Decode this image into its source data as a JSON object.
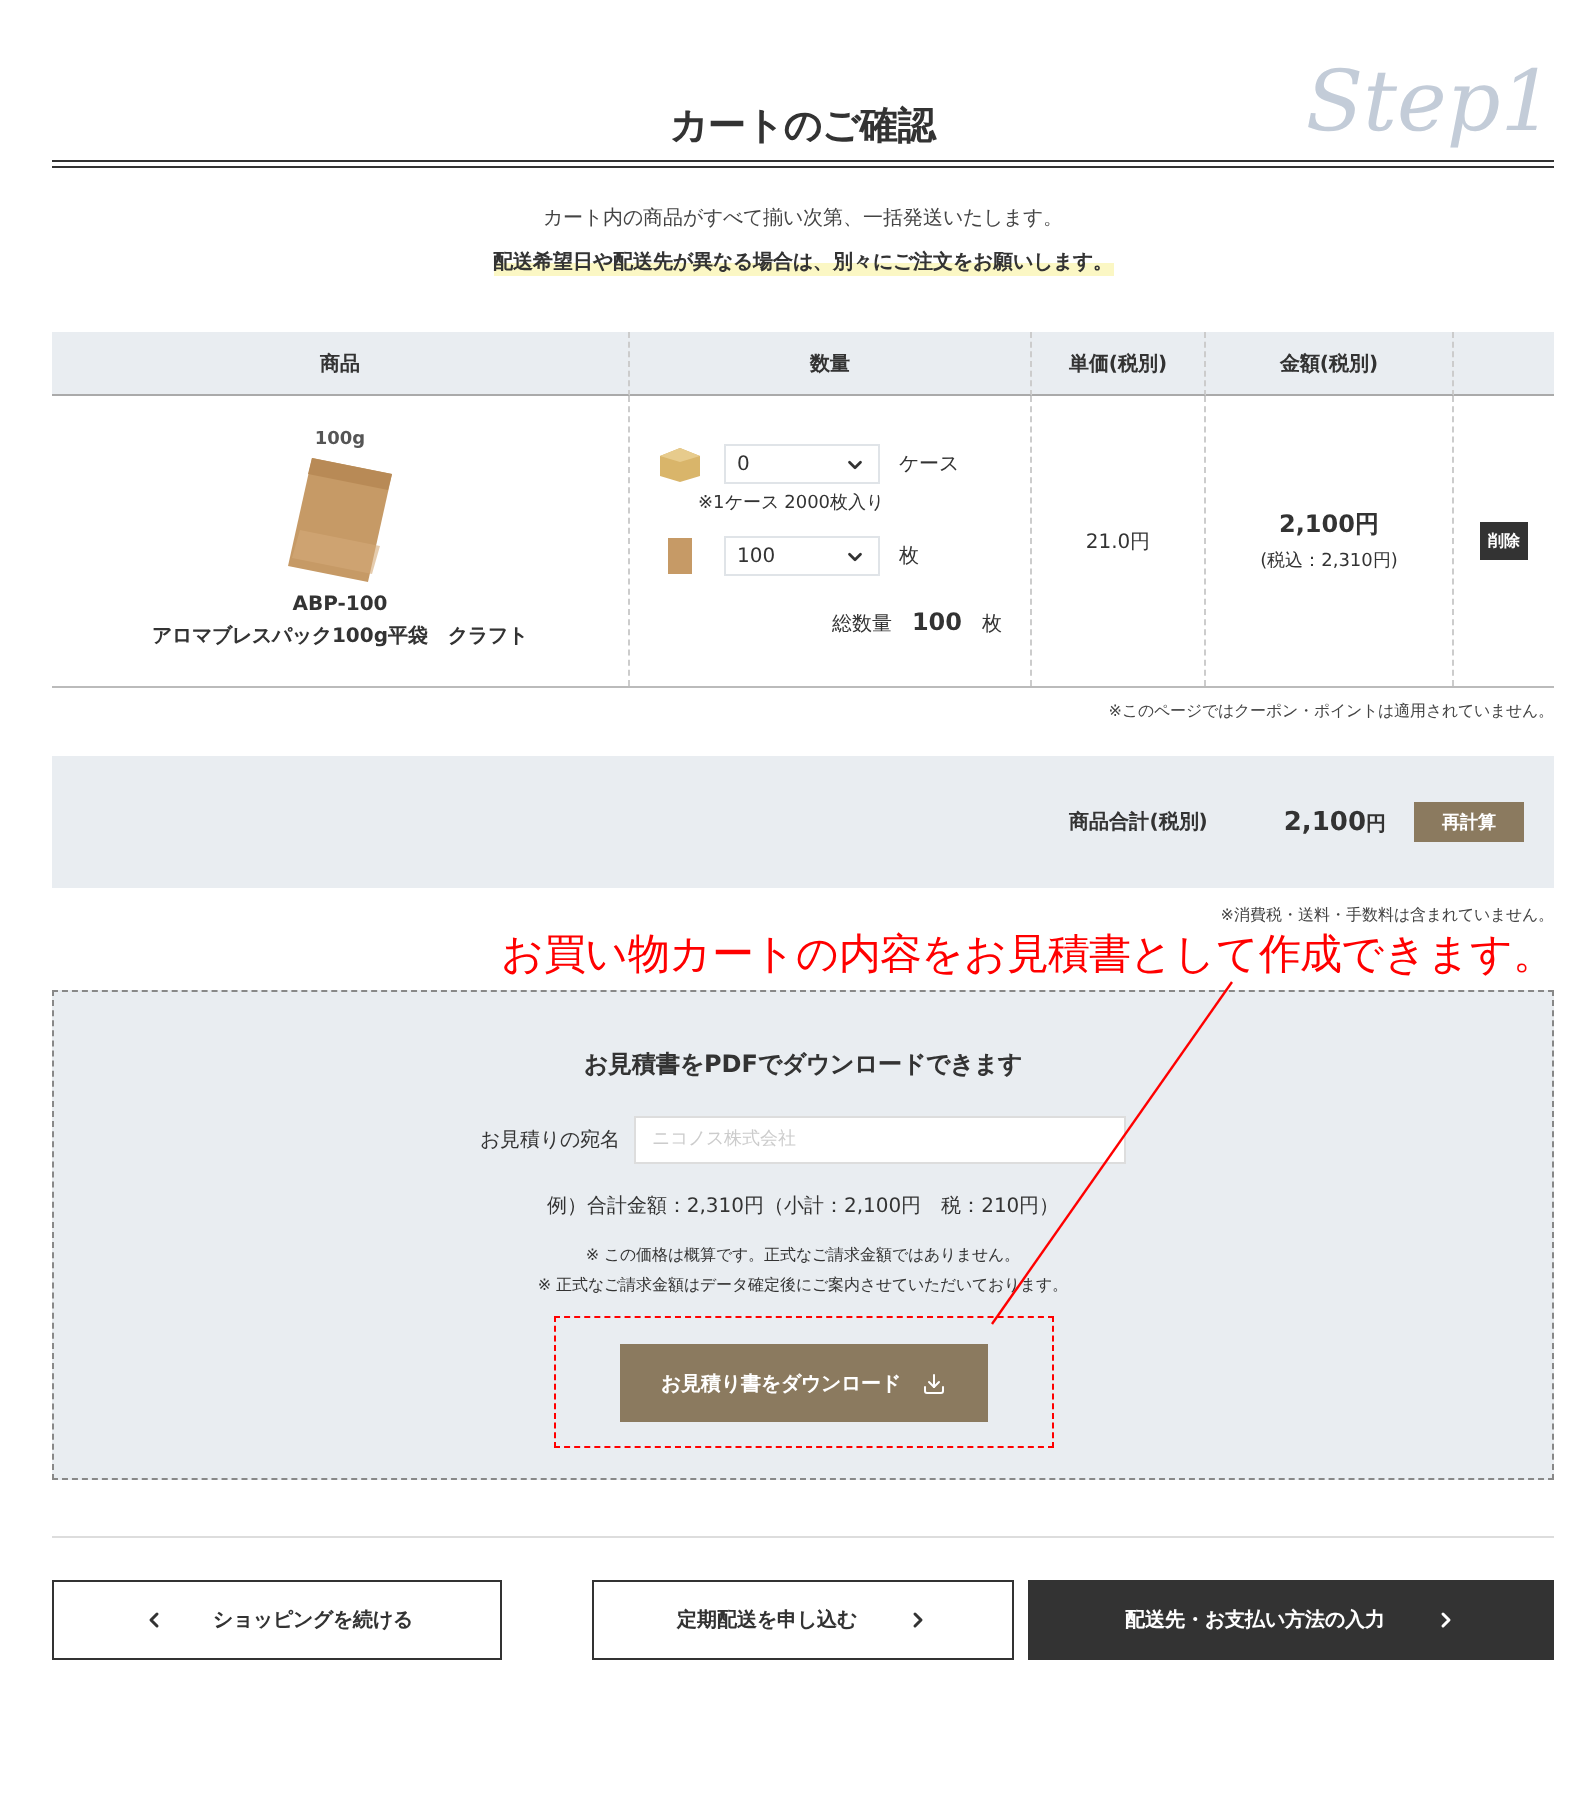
{
  "heading": {
    "title": "カートのご確認",
    "step": "Step1"
  },
  "intro": {
    "text": "カート内の商品がすべて揃い次第、一括発送いたします。",
    "highlight": "配送希望日や配送先が異なる場合は、別々にご注文をお願いします。"
  },
  "table": {
    "columns": [
      "商品",
      "数量",
      "単価(税別)",
      "金額(税別)"
    ],
    "rows": [
      {
        "size_label": "100g",
        "code": "ABP-100",
        "name": "アロマブレスパック100g平袋　クラフト",
        "quantities": [
          {
            "kind": "case",
            "value": "0",
            "unit": "ケース",
            "note": "※1ケース 2000枚入り"
          },
          {
            "kind": "sheet",
            "value": "100",
            "unit": "枚"
          }
        ],
        "total_label": "総数量",
        "total_qty": "100",
        "total_unit": "枚",
        "unit_price": "21.0円",
        "amount": "2,100円",
        "amount_incl": "(税込：2,310円)",
        "delete": "削除"
      }
    ]
  },
  "coupon_note": "※このページではクーポン・ポイントは適用されていません。",
  "summary": {
    "label": "商品合計(税別)",
    "value": "2,100",
    "currency": "円",
    "button": "再計算"
  },
  "tax_note": "※消費税・送料・手数料は含まれていません。",
  "annotation": "お買い物カートの内容をお見積書として作成できます。",
  "estimate": {
    "title": "お見積書をPDFでダウンロードできます",
    "field_label": "お見積りの宛名",
    "placeholder": "ニコノス株式会社",
    "example": "例）合計金額：2,310円（小計：2,100円　税：210円）",
    "notes": [
      "※ この価格は概算です。正式なご請求金額ではありません。",
      "※ 正式なご請求金額はデータ確定後にご案内させていただいております。"
    ],
    "button": "お見積り書をダウンロード"
  },
  "buttons": [
    {
      "kind": "back",
      "label": "ショッピングを続ける"
    },
    {
      "kind": "outline",
      "label": "定期配送を申し込む"
    },
    {
      "kind": "primary",
      "label": "配送先・お支払い方法の入力"
    }
  ]
}
